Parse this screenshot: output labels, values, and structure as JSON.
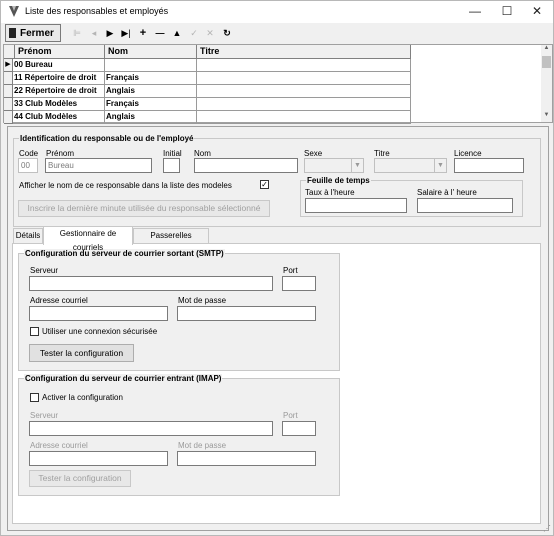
{
  "window": {
    "title": "Liste des responsables et employés"
  },
  "toolbar": {
    "close_label": "Fermer",
    "buttons": [
      {
        "name": "first-record-icon",
        "glyph": "⊩"
      },
      {
        "name": "prev-record-icon",
        "glyph": "◂"
      },
      {
        "name": "next-record-icon",
        "glyph": "▸"
      },
      {
        "name": "last-record-icon",
        "glyph": "▸|"
      },
      {
        "name": "add-icon",
        "glyph": "+"
      },
      {
        "name": "delete-icon",
        "glyph": "—"
      },
      {
        "name": "up-icon",
        "glyph": "▲"
      },
      {
        "name": "save-icon",
        "glyph": "✓"
      },
      {
        "name": "cancel-icon",
        "glyph": "✕"
      },
      {
        "name": "refresh-icon",
        "glyph": "↻"
      }
    ]
  },
  "grid": {
    "columns": [
      "Prénom",
      "Nom",
      "Titre"
    ],
    "rows": [
      {
        "prenom": "00 Bureau",
        "nom": "",
        "titre": ""
      },
      {
        "prenom": "11 Répertoire de droit",
        "nom": "Français",
        "titre": ""
      },
      {
        "prenom": "22 Répertoire de droit",
        "nom": "Anglais",
        "titre": ""
      },
      {
        "prenom": "33 Club Modèles",
        "nom": "Français",
        "titre": ""
      },
      {
        "prenom": "44 Club Modèles",
        "nom": "Anglais",
        "titre": ""
      }
    ]
  },
  "ident": {
    "title": "Identification du responsable ou de l'employé",
    "code_label": "Code",
    "code_value": "00",
    "prenom_label": "Prénom",
    "prenom_value": "Bureau",
    "initial_label": "Initial",
    "nom_label": "Nom",
    "sexe_label": "Sexe",
    "titre_label": "Titre",
    "licence_label": "Licence",
    "show_name_label": "Afficher le nom de ce responsable dans la liste des modeles",
    "show_name_checked": "✓",
    "insert_button": "Inscrire la dernière minute utilisée du responsable sélectionné",
    "timesheet_title": "Feuille de temps",
    "rate_label": "Taux à l'heure",
    "salary_label": "Salaire à l' heure"
  },
  "tabs": [
    "Détails",
    "Gestionnaire de courriels",
    "Passerelles externes"
  ],
  "smtp": {
    "title": "Configuration du serveur de courrier sortant (SMTP)",
    "server_label": "Serveur",
    "port_label": "Port",
    "email_label": "Adresse courriel",
    "password_label": "Mot de passe",
    "secure_label": "Utiliser une connexion sécurisée",
    "test_button": "Tester la configuration"
  },
  "imap": {
    "title": "Configuration du serveur de courrier entrant (IMAP)",
    "activate_label": "Activer la configuration",
    "server_label": "Serveur",
    "port_label": "Port",
    "email_label": "Adresse courriel",
    "password_label": "Mot de passe",
    "test_button": "Tester la configuration"
  }
}
